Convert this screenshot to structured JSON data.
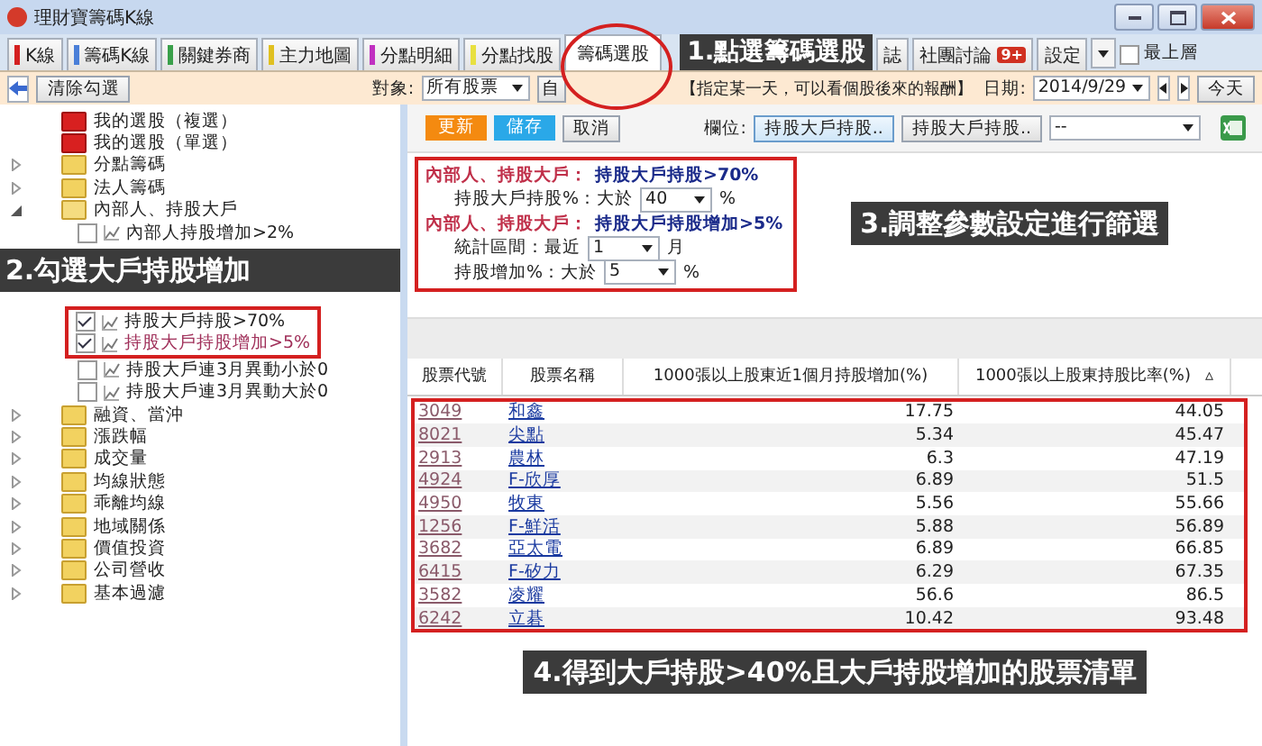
{
  "window": {
    "title": "理財寶籌碼K線"
  },
  "tabs": [
    {
      "label": "K線",
      "color": "#d42020",
      "selected": false
    },
    {
      "label": "籌碼K線",
      "color": "#4a7fd8",
      "selected": false
    },
    {
      "label": "關鍵券商",
      "color": "#3aa04a",
      "selected": false
    },
    {
      "label": "主力地圖",
      "color": "#e0c020",
      "selected": false
    },
    {
      "label": "分點明細",
      "color": "#c030c0",
      "selected": false
    },
    {
      "label": "分點找股",
      "color": "#e8e040",
      "selected": false
    },
    {
      "label": "籌碼選股",
      "selected": true
    }
  ],
  "tabs_right": {
    "partial_tab": "誌",
    "community": "社團討論",
    "badge": "9+",
    "settings": "設定",
    "always_on_top": {
      "label": "最上層",
      "checked": false
    }
  },
  "toolbar": {
    "clear": "清除勾選",
    "target_label": "對象:",
    "target": "所有股票",
    "self": "自",
    "hint": "【指定某一天，可以看個股後來的報酬】",
    "date_label": "日期:",
    "date": "2014/9/29",
    "today": "今天"
  },
  "tree": [
    {
      "label": "我的選股（複選）",
      "kind": "red-folder"
    },
    {
      "label": "我的選股（單選）",
      "kind": "red-folder"
    },
    {
      "label": "分點籌碼",
      "kind": "folder",
      "expanded": false
    },
    {
      "label": "法人籌碼",
      "kind": "folder",
      "expanded": false
    },
    {
      "label": "內部人、持股大戶",
      "kind": "folder",
      "expanded": true,
      "children": [
        {
          "label": "內部人持股增加>2%",
          "kind": "filter",
          "checked": false
        },
        {
          "kind": "callout",
          "label": "2.勾選大戶持股增加"
        },
        {
          "kind": "highlight-group",
          "children": [
            {
              "label": "持股大戶持股>70%",
              "kind": "filter",
              "checked": true
            },
            {
              "label": "持股大戶持股增加>5%",
              "kind": "filter",
              "checked": true
            }
          ]
        },
        {
          "label": "持股大戶連3月異動小於0",
          "kind": "filter",
          "checked": false
        },
        {
          "label": "持股大戶連3月異動大於0",
          "kind": "filter",
          "checked": false
        }
      ]
    },
    {
      "label": "融資、當沖",
      "kind": "folder",
      "expanded": false
    },
    {
      "label": "漲跌幅",
      "kind": "folder",
      "expanded": false
    },
    {
      "label": "成交量",
      "kind": "folder",
      "expanded": false
    },
    {
      "label": "均線狀態",
      "kind": "folder",
      "expanded": false
    },
    {
      "label": "乖離均線",
      "kind": "folder",
      "expanded": false
    },
    {
      "label": "地域關係",
      "kind": "folder",
      "expanded": false
    },
    {
      "label": "價值投資",
      "kind": "folder",
      "expanded": false
    },
    {
      "label": "公司營收",
      "kind": "folder",
      "expanded": false
    },
    {
      "label": "基本過濾",
      "kind": "folder",
      "expanded": false
    }
  ],
  "actions": {
    "update": "更新",
    "save": "儲存",
    "cancel": "取消",
    "field_label": "欄位:",
    "field_buttons": [
      "持股大戶持股..",
      "持股大戶持股.."
    ],
    "field_select": "--"
  },
  "filters": [
    {
      "kind": "title",
      "group": "內部人、持股大戶：",
      "name": "持股大戶持股>70%"
    },
    {
      "kind": "param",
      "label": "持股大戶持股%：大於",
      "value": "40",
      "unit": "%"
    },
    {
      "kind": "title",
      "group": "內部人、持股大戶：",
      "name": "持股大戶持股增加>5%"
    },
    {
      "kind": "param",
      "label": "統計區間：最近",
      "value": "1",
      "unit": "月"
    },
    {
      "kind": "param",
      "label": "持股增加%：大於",
      "value": "5",
      "unit": "%"
    }
  ],
  "callouts": {
    "step1": "1.點選籌碼選股",
    "step3": "3.調整參數設定進行篩選",
    "step4": "4.得到大戶持股>40%且大戶持股增加的股票清單"
  },
  "table": {
    "columns": [
      "股票代號",
      "股票名稱",
      "1000張以上股東近1個月持股增加(%)",
      "1000張以上股東持股比率(%)"
    ],
    "sort_mark": "▵",
    "rows": [
      [
        "3049",
        "和鑫",
        "17.75",
        "44.05"
      ],
      [
        "8021",
        "尖點",
        "5.34",
        "45.47"
      ],
      [
        "2913",
        "農林",
        "6.3",
        "47.19"
      ],
      [
        "4924",
        "F-欣厚",
        "6.89",
        "51.5"
      ],
      [
        "4950",
        "牧東",
        "5.56",
        "55.66"
      ],
      [
        "1256",
        "F-鮮活",
        "5.88",
        "56.89"
      ],
      [
        "3682",
        "亞太電",
        "6.89",
        "66.85"
      ],
      [
        "6415",
        "F-矽力",
        "6.29",
        "67.35"
      ],
      [
        "3582",
        "凌耀",
        "56.6",
        "86.5"
      ],
      [
        "6242",
        "立碁",
        "10.42",
        "93.48"
      ]
    ]
  }
}
